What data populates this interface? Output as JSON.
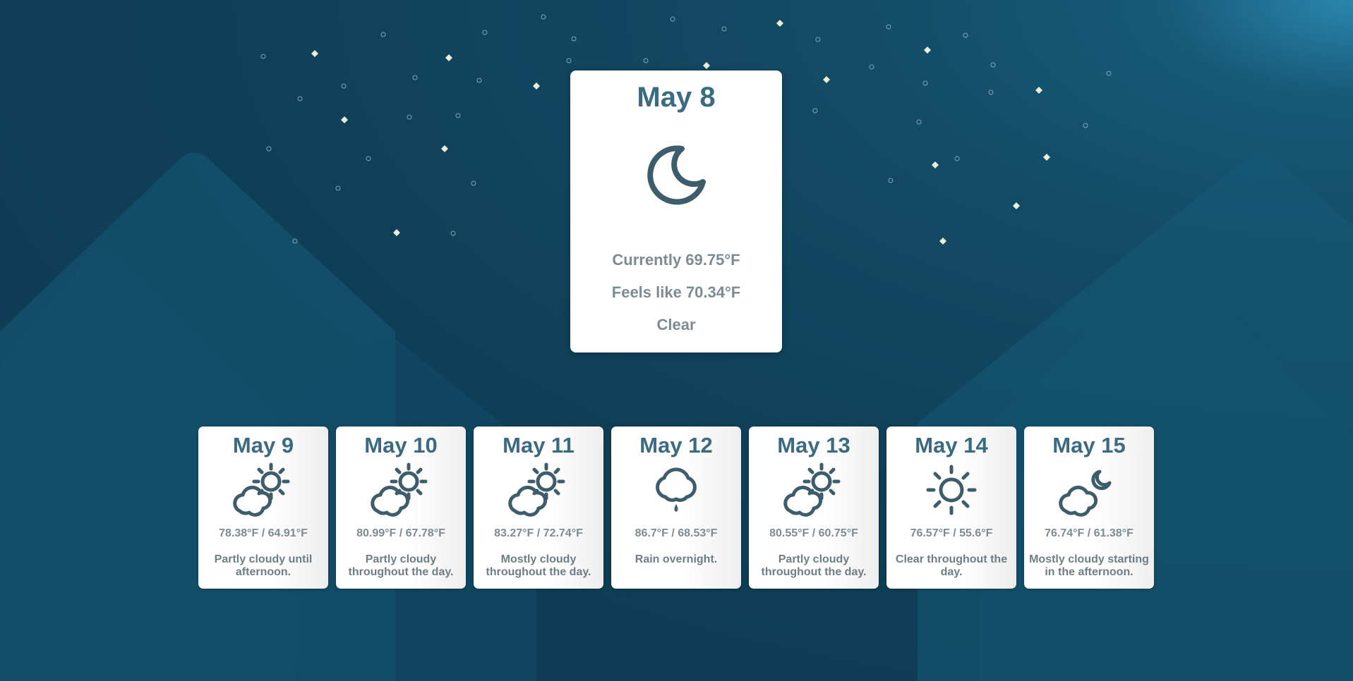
{
  "colors": {
    "background": "#0f3f57",
    "card": "#ffffff",
    "date_text": "#3b6b82",
    "detail_text": "#7d8b93",
    "icon": "#3d5d6c",
    "star": "#e8efd6"
  },
  "today": {
    "date": "May 8",
    "icon": "moon-icon",
    "current": "Currently 69.75°F",
    "feels_like": "Feels like 70.34°F",
    "summary": "Clear"
  },
  "forecast": [
    {
      "date": "May 9",
      "icon": "partly-cloudy-day-icon",
      "temps": "78.38°F / 64.91°F",
      "summary": "Partly cloudy until afternoon."
    },
    {
      "date": "May 10",
      "icon": "partly-cloudy-day-icon",
      "temps": "80.99°F / 67.78°F",
      "summary": "Partly cloudy throughout the day."
    },
    {
      "date": "May 11",
      "icon": "partly-cloudy-day-icon",
      "temps": "83.27°F / 72.74°F",
      "summary": "Mostly cloudy throughout the day."
    },
    {
      "date": "May 12",
      "icon": "rain-icon",
      "temps": "86.7°F / 68.53°F",
      "summary": "Rain overnight."
    },
    {
      "date": "May 13",
      "icon": "partly-cloudy-day-icon",
      "temps": "80.55°F / 60.75°F",
      "summary": "Partly cloudy throughout the day."
    },
    {
      "date": "May 14",
      "icon": "clear-day-icon",
      "temps": "76.57°F / 55.6°F",
      "summary": "Clear throughout the day."
    },
    {
      "date": "May 15",
      "icon": "partly-cloudy-night-icon",
      "temps": "76.74°F / 61.38°F",
      "summary": "Mostly cloudy starting in the afternoon."
    }
  ]
}
